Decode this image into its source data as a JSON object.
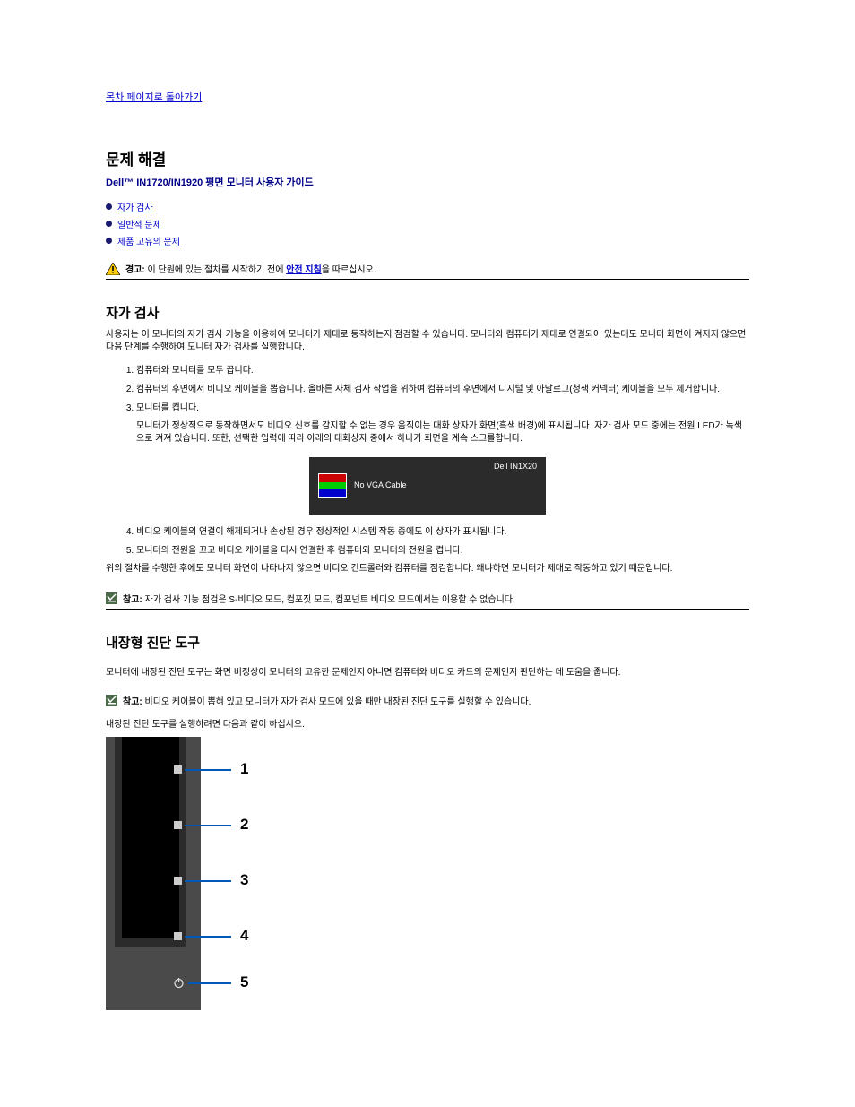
{
  "back_link": "목차 페이지로 돌아가기",
  "title": "문제 해결",
  "subtitle": "Dell™ IN1720/IN1920 평면 모니터 사용자 가이드",
  "bullets": {
    "b1": "자가 검사",
    "b2": "일반적 문제",
    "b3": "제품 고유의 문제"
  },
  "caution": {
    "label": "경고:",
    "text1": " 이 단원에 있는 절차를 시작하기 전에 ",
    "link": "안전 지침",
    "text2": "을 따르십시오."
  },
  "self_test": {
    "heading": "자가 검사",
    "p1": "사용자는 이 모니터의 자가 검사 기능을 이용하여 모니터가 제대로 동작하는지 점검할 수 있습니다. 모니터와 컴퓨터가 제대로 연결되어 있는데도 모니터 화면이 켜지지 않으면 다음 단계를 수행하여 모니터 자가 검사를 실행합니다.",
    "li1": "컴퓨터와 모니터를 모두 끕니다.",
    "li2": "컴퓨터의 후면에서 비디오 케이블을 뽑습니다. 올바른 자체 검사 작업을 위하여 컴퓨터의 후면에서 디지털 및 아날로그(청색 커넥터) 케이블을 모두 제거합니다.",
    "li3": "모니터를 켭니다.",
    "p2": "모니터가 정상적으로 동작하면서도 비디오 신호를 감지할 수 없는 경우 움직이는 대화 상자가 화면(흑색 배경)에 표시됩니다. 자가 검사 모드 중에는 전원 LED가 녹색으로 켜져 있습니다. 또한, 선택한 입력에 따라 아래의 대화상자 중에서 하나가 화면을 계속 스크롤합니다.",
    "osd_model": "Dell IN1X20",
    "osd_msg": "No VGA Cable",
    "li4": "비디오 케이블의 연결이 해제되거나 손상된 경우 정상적인 시스템 작동 중에도 이 상자가 표시됩니다.",
    "li5": "모니터의 전원을 끄고 비디오 케이블을 다시 연결한 후 컴퓨터와 모니터의 전원을 켭니다.",
    "p3": "위의 절차를 수행한 후에도 모니터 화면이 나타나지 않으면 비디오 컨트롤러와 컴퓨터를 점검합니다. 왜냐하면 모니터가 제대로 작동하고 있기 때문입니다."
  },
  "note1": {
    "label": "참고:",
    "text": " 자가 검사 기능 점검은 S-비디오 모드, 컴포짓 모드, 컴포넌트 비디오 모드에서는 이용할 수 없습니다."
  },
  "bid": {
    "heading": "내장형 진단 도구",
    "p1": "모니터에 내장된 진단 도구는 화면 비정상이 모니터의 고유한 문제인지 아니면 컴퓨터와 비디오 카드의 문제인지 판단하는 데 도움을 줍니다.",
    "note_label": "참고:",
    "note_text": " 비디오 케이블이 뽑혀 있고 모니터가 자가 검사 모드에 있을 때만 내장된 진단 도구를 실행할 수 있습니다.",
    "p2": "내장된 진단 도구를 실행하려면 다음과 같이 하십시오.",
    "labels": {
      "n1": "1",
      "n2": "2",
      "n3": "3",
      "n4": "4",
      "n5": "5"
    }
  }
}
